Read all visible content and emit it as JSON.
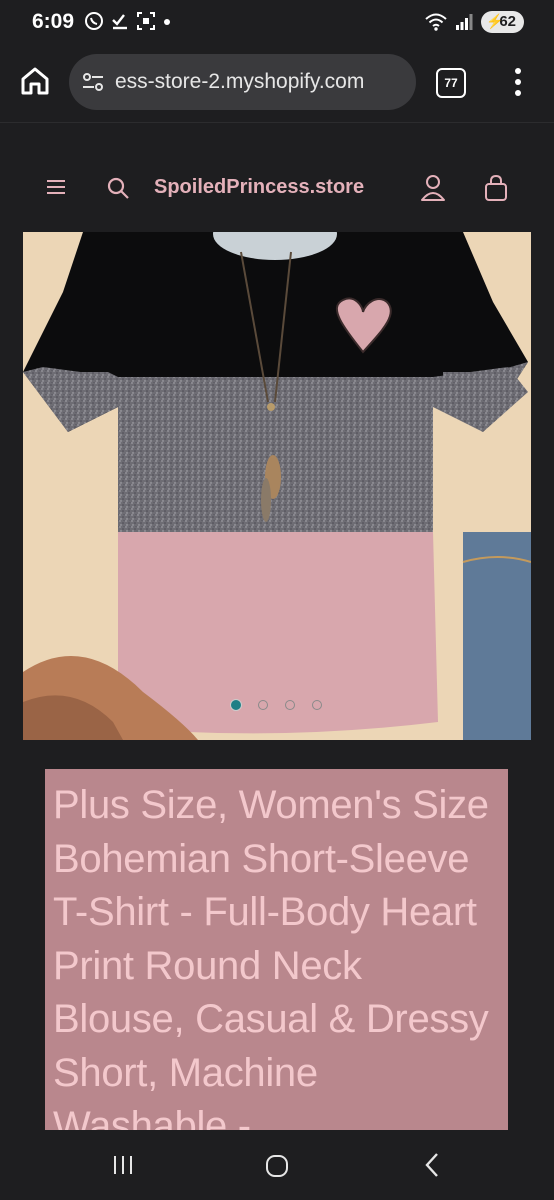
{
  "status_bar": {
    "time": "6:09",
    "battery": "62",
    "icons": [
      "whatsapp-icon",
      "check-download-icon",
      "screenshot-icon",
      "dot-icon",
      "wifi-icon",
      "signal-icon",
      "battery-icon"
    ]
  },
  "browser": {
    "url": "ess-store-2.myshopify.com",
    "tab_count": "77"
  },
  "store": {
    "brand": "SpoiledPrincess.store"
  },
  "product": {
    "title": "Plus Size, Women's Size Bohemian Short-Sleeve T-Shirt - Full-Body Heart Print Round Neck Blouse, Casual & Dressy Short, Machine Washable -",
    "image_count": 4,
    "active_image": 1
  },
  "colors": {
    "background": "#1e1e20",
    "brand_pink": "#e4b1ba",
    "title_box": "#b9878d",
    "title_text": "#f3c8cc",
    "active_dot": "#1e7f86"
  }
}
